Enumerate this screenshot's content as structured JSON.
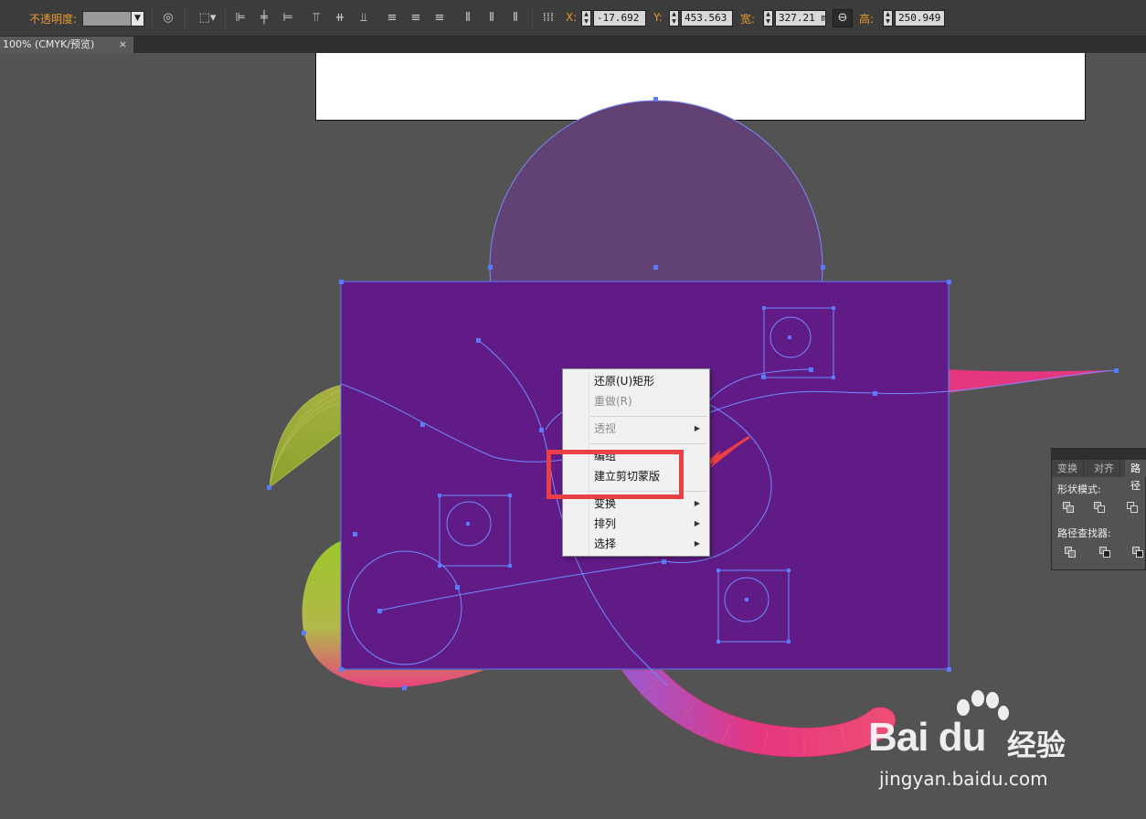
{
  "toolbar": {
    "opacity_label": "不透明度:",
    "x_label": "X:",
    "y_label": "Y:",
    "w_label": "宽:",
    "h_label": "高:",
    "x_value": "-17.692",
    "y_value": "453.563",
    "w_value": "327.21 m",
    "h_value": "250.949"
  },
  "tab": {
    "title": "100% (CMYK/预览)",
    "close": "×"
  },
  "context_menu": {
    "items": [
      {
        "label": "还原(U)矩形",
        "enabled": true,
        "submenu": false
      },
      {
        "label": "重做(R)",
        "enabled": false,
        "submenu": false
      },
      {
        "label": "透视",
        "enabled": false,
        "submenu": true
      },
      {
        "label": "编组",
        "enabled": true,
        "submenu": false
      },
      {
        "label": "建立剪切蒙版",
        "enabled": true,
        "submenu": false
      },
      {
        "label": "变换",
        "enabled": true,
        "submenu": true
      },
      {
        "label": "排列",
        "enabled": true,
        "submenu": true
      },
      {
        "label": "选择",
        "enabled": true,
        "submenu": true
      }
    ],
    "highlighted_item": "建立剪切蒙版"
  },
  "panel": {
    "tabs": [
      "变换",
      "对齐",
      "路径"
    ],
    "active_tab": "路径",
    "shape_modes_label": "形状模式:",
    "pathfinder_label": "路径查找器:"
  },
  "watermark": {
    "logo_text": "Bai du",
    "logo_cn": "经验",
    "url": "jingyan.baidu.com"
  },
  "colors": {
    "accent_label": "#e69b2e",
    "purple_rect": "#611b86",
    "circle_fill": "#624274",
    "selection_blue": "#4d6ef5",
    "highlight_red": "#ea3f45",
    "pink_stroke": "#e43a86",
    "green_fill": "#96c12d"
  },
  "icons": [
    "opacity-dropdown-icon",
    "recolor-icon",
    "select-similar-icon",
    "align-left-icon",
    "align-hcenter-icon",
    "align-right-icon",
    "align-top-icon",
    "align-vcenter-icon",
    "align-bottom-icon",
    "distribute-icon",
    "transform-grid-icon",
    "link-icon",
    "close-icon",
    "submenu-arrow-icon",
    "pointer-arrow-icon",
    "paw-logo-icon"
  ]
}
